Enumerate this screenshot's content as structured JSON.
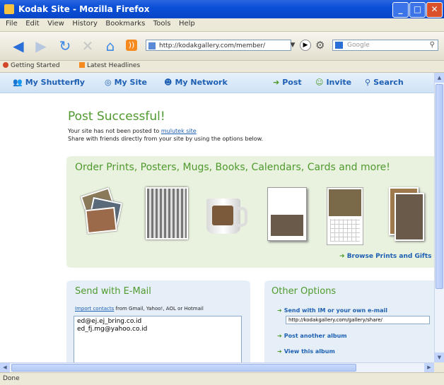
{
  "window": {
    "title": "Kodak Site - Mozilla Firefox"
  },
  "menu": [
    "File",
    "Edit",
    "View",
    "History",
    "Bookmarks",
    "Tools",
    "Help"
  ],
  "navbar": {
    "url": "http://kodakgallery.com/member/",
    "search_placeholder": "Google"
  },
  "bookmarks": [
    "Getting Started",
    "Latest Headlines"
  ],
  "site_nav": {
    "items": [
      "My Shutterfly",
      "My Site",
      "My Network",
      "Post",
      "Invite",
      "Search"
    ]
  },
  "success": {
    "title": "Post Successful!",
    "line1_prefix": "Your site has not been posted to ",
    "line1_link": "mulutek site",
    "line1_suffix": "",
    "line2": "Share with friends directly from your site by using the options below."
  },
  "prints": {
    "title": "Order Prints, Posters, Mugs, Books, Calendars, Cards and more!",
    "browse_link": "Browse Prints and Gifts"
  },
  "email": {
    "title": "Send with E-Mail",
    "hint_link": "Import contacts",
    "hint_text": " from Gmail, Yahoo!, AOL or Hotmail",
    "recipients": [
      "ed@ej.ej_bring.co.id",
      "ed_fj.mg@yahoo.co.id"
    ]
  },
  "options": {
    "title": "Other Options",
    "items": [
      "Send with IM or your own e-mail",
      "Post another album",
      "View this album"
    ],
    "share_url": "http://kodakgallery.com/gallery/share/"
  },
  "status": {
    "text": "Done"
  },
  "colors": {
    "accent_green": "#4f9a2e",
    "link_blue": "#1d5fb3",
    "titlebar_blue": "#0a4fd6"
  }
}
